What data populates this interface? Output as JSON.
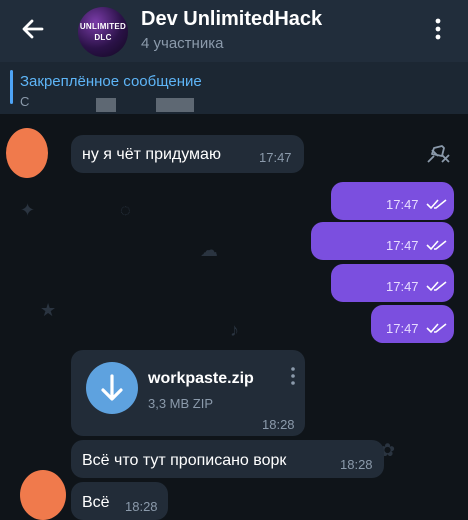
{
  "header": {
    "title": "Dev UnlimitedHack",
    "subtitle": "4 участника",
    "avatar_text_top": "UNLIMITED",
    "avatar_text_bottom": "DLC",
    "back_icon": "arrow-left-icon",
    "menu_icon": "more-vertical-icon"
  },
  "pinned": {
    "title": "Закреплённое сообщение",
    "preview": "С",
    "icon": "unpin-icon"
  },
  "messages": [
    {
      "type": "incoming",
      "text": "ну я чёт придумаю",
      "time": "17:47"
    },
    {
      "type": "outgoing",
      "time": "17:47",
      "status": "read"
    },
    {
      "type": "outgoing",
      "time": "17:47",
      "status": "read"
    },
    {
      "type": "outgoing",
      "time": "17:47",
      "status": "read"
    },
    {
      "type": "outgoing",
      "time": "17:47",
      "status": "read"
    },
    {
      "type": "file",
      "file_name": "workpaste.zip",
      "file_meta": "3,3 MB ZIP",
      "time": "18:28",
      "icon": "download-icon"
    },
    {
      "type": "incoming",
      "text": "Всё что тут прописано ворк",
      "time": "18:28"
    },
    {
      "type": "incoming",
      "text": "Всё",
      "time": "18:28"
    }
  ],
  "colors": {
    "header_bg": "#212d3b",
    "chat_bg": "#0f1419",
    "incoming_bubble": "#222c38",
    "outgoing_bubble": "#7b4fdf",
    "accent_blue": "#5eb5f7",
    "file_icon_bg": "#5ea2df"
  }
}
